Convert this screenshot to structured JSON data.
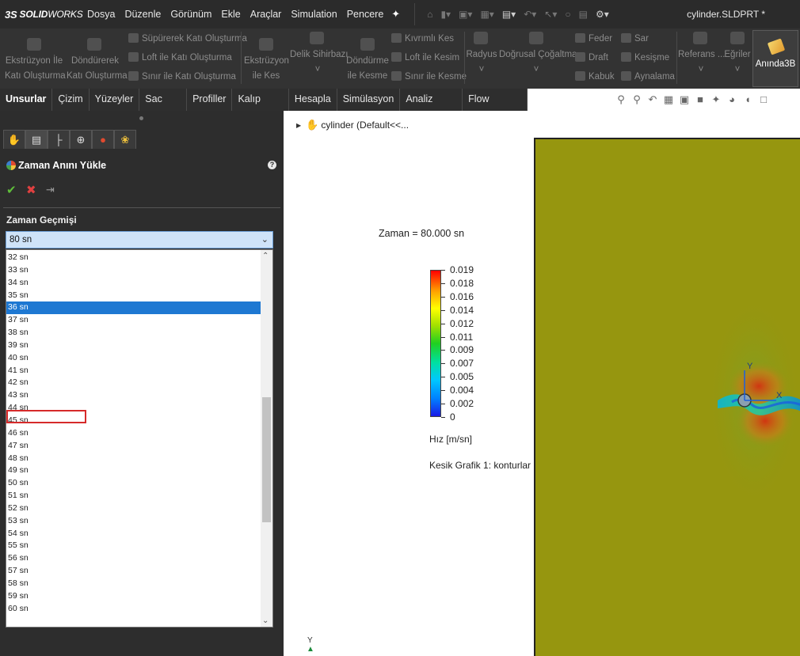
{
  "app": {
    "logo_ds": "3S",
    "logo_bold": "SOLID",
    "logo_light": "WORKS",
    "document_title": "cylinder.SLDPRT *"
  },
  "menu": {
    "items": [
      "Dosya",
      "Düzenle",
      "Görünüm",
      "Ekle",
      "Araçlar",
      "Simulation",
      "Pencere"
    ]
  },
  "ribbon": {
    "extrude_boss": [
      "Ekstrüzyon İle",
      "Katı Oluşturma"
    ],
    "revolve_boss": [
      "Döndürerek",
      "Katı Oluşturma"
    ],
    "swept_boss": "Süpürerek Katı Oluşturma",
    "loft_boss": "Loft ile Katı Oluşturma",
    "boundary_boss": "Sınır ile Katı Oluşturma",
    "extrude_cut": [
      "Ekstrüzyon",
      "ile Kes"
    ],
    "hole_wizard": "Delik Sihirbazı",
    "revolve_cut": [
      "Döndürme",
      "ile Kesme"
    ],
    "swept_cut": "Kıvrımlı Kes",
    "loft_cut": "Loft ile Kesim",
    "boundary_cut": "Sınır ile Kesme",
    "fillet": "Radyus",
    "linear_pattern": "Doğrusal Çoğaltma",
    "rib": "Feder",
    "draft": "Draft",
    "shell": "Kabuk",
    "wrap": "Sar",
    "intersect": "Kesişme",
    "mirror": "Aynalama",
    "reference": "Referans ...",
    "curves": "Eğriler",
    "instant3d": "Anında3B"
  },
  "tabs": [
    "Unsurlar",
    "Çizim",
    "Yüzeyler",
    "Sac Levha",
    "Profiller",
    "Kalıp Araçları",
    "Hesapla",
    "Simülasyon",
    "Analiz Hazırlığı",
    "Flow Simulation"
  ],
  "property_manager": {
    "title": "Zaman Anını Yükle",
    "section_title": "Zaman Geçmişi",
    "selected_value": "80 sn",
    "list_items": [
      "32 sn",
      "33 sn",
      "34 sn",
      "35 sn",
      "36 sn",
      "37 sn",
      "38 sn",
      "39 sn",
      "40 sn",
      "41 sn",
      "42 sn",
      "43 sn",
      "44 sn",
      "45 sn",
      "46 sn",
      "47 sn",
      "48 sn",
      "49 sn",
      "50 sn",
      "51 sn",
      "52 sn",
      "53 sn",
      "54 sn",
      "55 sn",
      "56 sn",
      "57 sn",
      "58 sn",
      "59 sn",
      "60 sn"
    ],
    "highlighted_item": "36 sn"
  },
  "graphics": {
    "tree_node": "cylinder  (Default<<...",
    "time_label": "Zaman = 80.000 sn",
    "legend_values": [
      "0.019",
      "0.018",
      "0.016",
      "0.014",
      "0.012",
      "0.011",
      "0.009",
      "0.007",
      "0.005",
      "0.004",
      "0.002",
      "0"
    ],
    "legend_unit": "Hız [m/sn]",
    "plot_name": "Kesik Grafik 1: konturlar",
    "axis_y": "Y",
    "axis_x": "X"
  },
  "colors": {
    "background_field": "#96960f",
    "selection": "#1e78d2",
    "highlight_outline": "#d62a2a"
  }
}
